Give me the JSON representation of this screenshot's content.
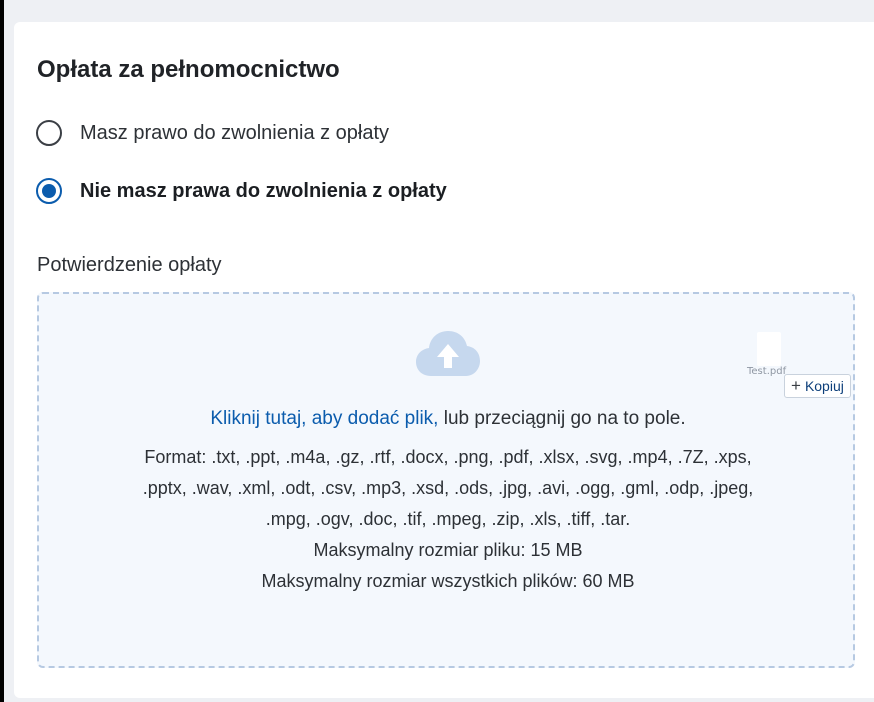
{
  "section": {
    "title": "Opłata za pełnomocnictwo"
  },
  "fee_options": [
    {
      "label": "Masz prawo do zwolnienia z opłaty",
      "selected": false
    },
    {
      "label": "Nie masz prawa do zwolnienia z opłaty",
      "selected": true
    }
  ],
  "confirmation": {
    "label": "Potwierdzenie opłaty",
    "upload_link": "Kliknij tutaj, aby dodać plik,",
    "upload_suffix": " lub przeciągnij go na to pole.",
    "formats": "Format: .txt, .ppt, .m4a, .gz, .rtf, .docx, .png, .pdf, .xlsx, .svg, .mp4, .7Z, .xps, .pptx, .wav, .xml, .odt, .csv, .mp3, .xsd, .ods, .jpg, .avi, .ogg, .gml, .odp, .jpeg, .mpg, .ogv, .doc, .tif, .mpeg, .zip, .xls, .tiff, .tar.",
    "max_file": "Maksymalny rozmiar pliku: 15 MB",
    "max_total": "Maksymalny rozmiar wszystkich plików: 60 MB",
    "icon": "cloud-upload-icon"
  },
  "drag_ghost": {
    "file_name": "Test.pdf",
    "tooltip": "Kopiuj"
  },
  "colors": {
    "accent": "#0b5cad",
    "dropzone_bg": "#f4f8fd",
    "dropzone_border": "#b6c9e2",
    "cloud_icon": "#c6d8ee"
  }
}
